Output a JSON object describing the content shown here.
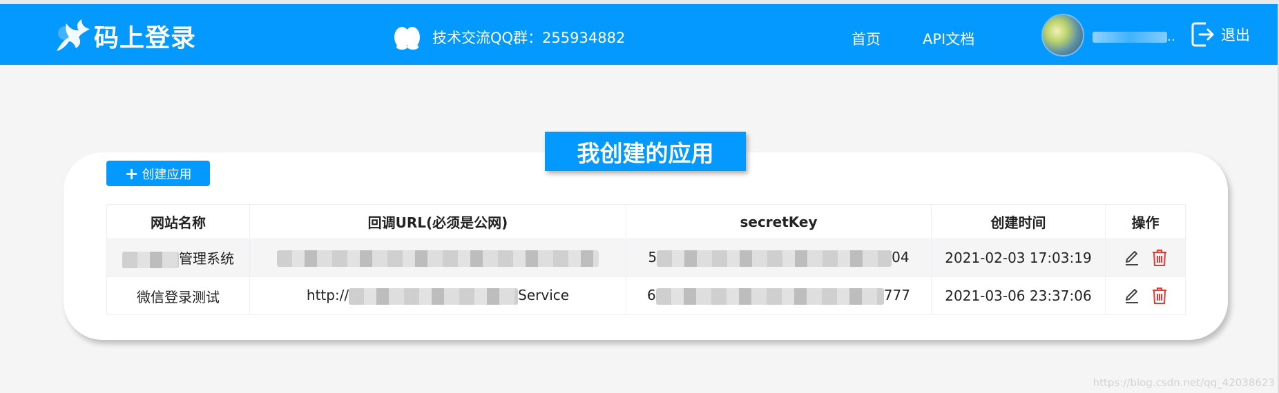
{
  "header": {
    "brand": "码上登录",
    "qq_group": "技术交流QQ群：255934882",
    "nav": {
      "home": "首页",
      "api_docs": "API文档"
    },
    "username_visible": "..",
    "logout": "退出"
  },
  "main": {
    "section_title": "我创建的应用",
    "create_button": "创建应用",
    "table": {
      "columns": [
        "网站名称",
        "回调URL(必须是公网)",
        "secretKey",
        "创建时间",
        "操作"
      ],
      "rows": [
        {
          "name_prefix": "",
          "name_suffix": "管理系统",
          "callback_prefix": "",
          "callback_suffix": "",
          "secret_prefix": "5",
          "secret_suffix": "04",
          "created": "2021-02-03 17:03:19"
        },
        {
          "name_prefix": "微信登录测试",
          "name_suffix": "",
          "callback_prefix": "http://",
          "callback_suffix": "Service",
          "secret_prefix": "6",
          "secret_suffix": "777",
          "created": "2021-03-06 23:37:06"
        }
      ]
    }
  },
  "watermark": "https://blog.csdn.net/qq_42038623",
  "colors": {
    "brand_blue": "#0399fe",
    "delete_red": "#e53935"
  },
  "icons": {
    "brand": "pegasus-icon",
    "qq": "qq-penguin-icon",
    "logout": "logout-icon",
    "edit": "pencil-icon",
    "delete": "trash-icon"
  }
}
